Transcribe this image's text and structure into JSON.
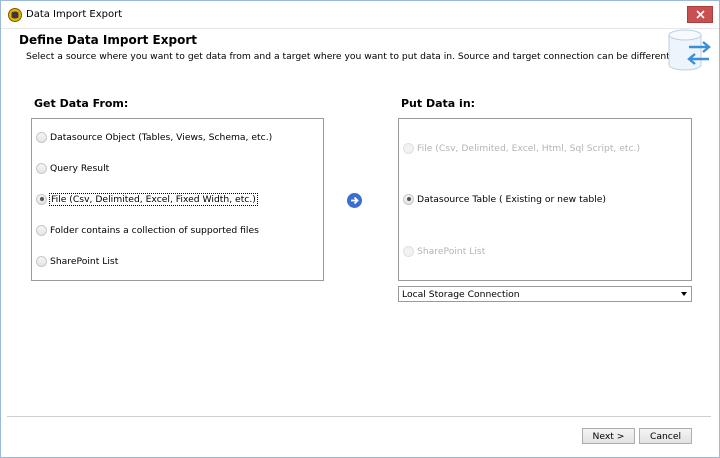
{
  "window": {
    "title": "Data Import Export"
  },
  "header": {
    "title": "Define Data Import Export",
    "subtitle": "Select a source where you want to get data from and a target where you want to put data in. Source and target connection can be different."
  },
  "source": {
    "label": "Get Data From:",
    "options": [
      {
        "label": "Datasource Object (Tables, Views, Schema, etc.)",
        "selected": false
      },
      {
        "label": "Query Result",
        "selected": false
      },
      {
        "label": "File (Csv, Delimited, Excel, Fixed Width, etc.)",
        "selected": true
      },
      {
        "label": "Folder contains a collection of supported files",
        "selected": false
      },
      {
        "label": "SharePoint List",
        "selected": false
      }
    ]
  },
  "target": {
    "label": "Put Data in:",
    "options": [
      {
        "label": "File (Csv, Delimited, Excel, Html, Sql Script, etc.)",
        "selected": false,
        "enabled": false
      },
      {
        "label": "Datasource Table ( Existing or new table)",
        "selected": true,
        "enabled": true
      },
      {
        "label": "SharePoint List",
        "selected": false,
        "enabled": false
      }
    ],
    "connection": "Local Storage Connection"
  },
  "footer": {
    "next_label": "Next >",
    "cancel_label": "Cancel"
  },
  "icons": {
    "app": "database-app-icon",
    "header": "data-transfer-icon",
    "arrow": "arrow-right-icon"
  },
  "colors": {
    "accent": "#3a6fd1",
    "close": "#c75050",
    "header_icon": "#3a8fd6"
  }
}
